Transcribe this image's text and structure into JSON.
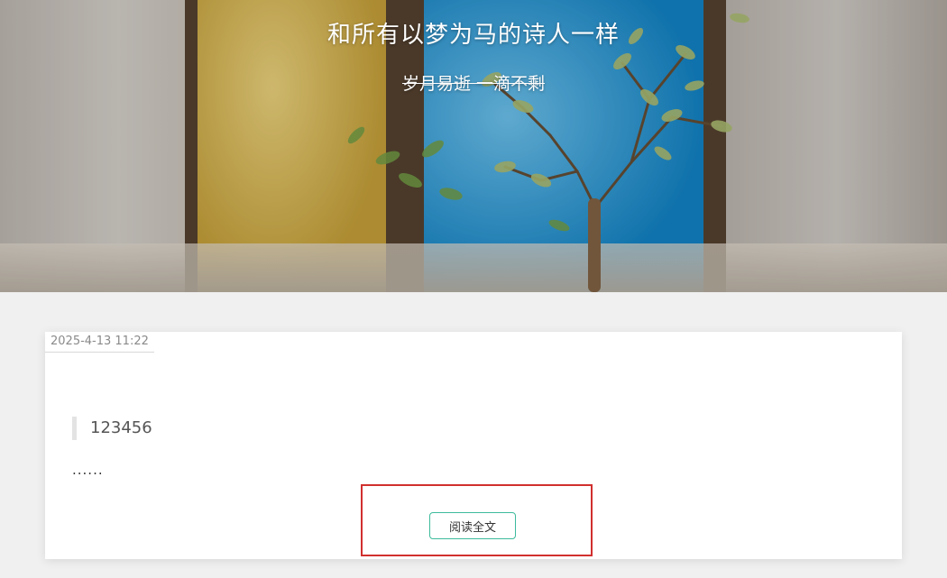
{
  "hero": {
    "title": "和所有以梦为马的诗人一样",
    "subtitle": "岁月易逝 一滴不剩"
  },
  "post": {
    "date": "2025-4-13 11:22",
    "quote": "123456",
    "excerpt": "......",
    "read_more_label": "阅读全文"
  },
  "colors": {
    "accent_border": "#3dbb9c",
    "highlight_box": "#d0302e"
  }
}
